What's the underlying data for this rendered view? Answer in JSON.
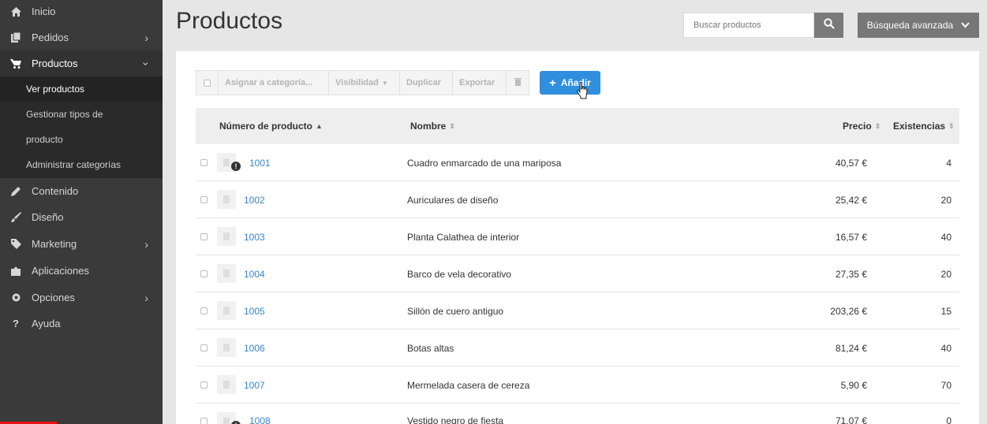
{
  "sidebar": {
    "items": [
      {
        "label": "Inicio",
        "icon": "home-icon",
        "has_chevron": false
      },
      {
        "label": "Pedidos",
        "icon": "clipboard-icon",
        "has_chevron": true
      },
      {
        "label": "Productos",
        "icon": "cart-icon",
        "has_chevron": true,
        "expanded": true
      },
      {
        "label": "Contenido",
        "icon": "pencil-icon",
        "has_chevron": false
      },
      {
        "label": "Diseño",
        "icon": "brush-icon",
        "has_chevron": false
      },
      {
        "label": "Marketing",
        "icon": "tag-icon",
        "has_chevron": true
      },
      {
        "label": "Aplicaciones",
        "icon": "puzzle-icon",
        "has_chevron": false
      },
      {
        "label": "Opciones",
        "icon": "gear-icon",
        "has_chevron": true
      },
      {
        "label": "Ayuda",
        "icon": "question-icon",
        "has_chevron": false
      }
    ],
    "subitems": [
      {
        "label": "Ver productos",
        "active": true
      },
      {
        "label": "Gestionar tipos de",
        "active": false
      },
      {
        "label": "producto",
        "active": false
      },
      {
        "label": "Administrar categorías",
        "active": false
      }
    ]
  },
  "header": {
    "title": "Productos",
    "search_placeholder": "Buscar productos",
    "advanced_search_label": "Búsqueda avanzada"
  },
  "toolbar": {
    "assign_category": "Asignar a categoría...",
    "visibility": "Visibilidad",
    "duplicate": "Duplicar",
    "export": "Exportar",
    "add_label": "Añadir"
  },
  "table": {
    "columns": {
      "number": "Número de producto",
      "name": "Nombre",
      "price": "Precio",
      "stock": "Existencias"
    },
    "rows": [
      {
        "number": "1001",
        "name": "Cuadro enmarcado de una mariposa",
        "price": "40,57 €",
        "stock": "4",
        "warning": true
      },
      {
        "number": "1002",
        "name": "Auriculares de diseño",
        "price": "25,42 €",
        "stock": "20",
        "warning": false
      },
      {
        "number": "1003",
        "name": "Planta Calathea de interior",
        "price": "16,57 €",
        "stock": "40",
        "warning": false
      },
      {
        "number": "1004",
        "name": "Barco de vela decorativo",
        "price": "27,35 €",
        "stock": "20",
        "warning": false
      },
      {
        "number": "1005",
        "name": "Sillón de cuero antiguo",
        "price": "203,26 €",
        "stock": "15",
        "warning": false
      },
      {
        "number": "1006",
        "name": "Botas altas",
        "price": "81,24 €",
        "stock": "40",
        "warning": false
      },
      {
        "number": "1007",
        "name": "Mermelada casera de cereza",
        "price": "5,90 €",
        "stock": "70",
        "warning": false
      },
      {
        "number": "1008",
        "name": "Vestido negro de fiesta",
        "price": "71,07 €",
        "stock": "0",
        "warning": true
      }
    ]
  },
  "colors": {
    "sidebar_bg": "#3a3a3a",
    "accent": "#2f8fde",
    "link": "#3a85c8"
  }
}
